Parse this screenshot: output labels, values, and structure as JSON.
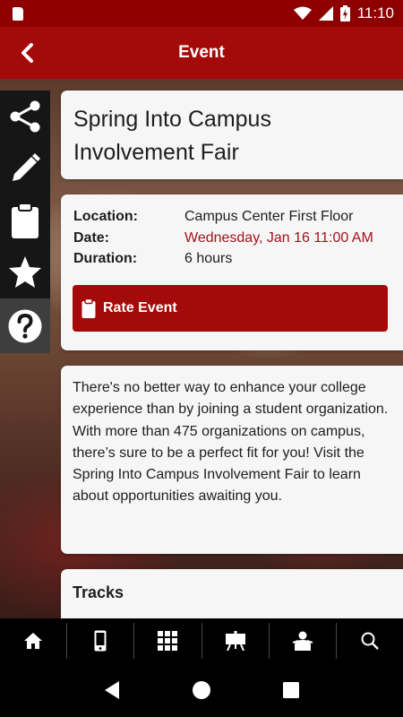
{
  "status_bar": {
    "time": "11:10",
    "icons": [
      "sd-card-icon",
      "wifi-icon",
      "cell-signal-icon",
      "battery-charging-icon"
    ]
  },
  "app_bar": {
    "title": "Event",
    "back_icon": "chevron-left-icon"
  },
  "side_toolbar": {
    "items": [
      {
        "icon": "share-icon"
      },
      {
        "icon": "pencil-icon"
      },
      {
        "icon": "clipboard-icon"
      },
      {
        "icon": "star-icon"
      },
      {
        "icon": "help-icon"
      }
    ]
  },
  "event": {
    "title": "Spring Into Campus Involvement Fair",
    "details": [
      {
        "label": "Location:",
        "value": "Campus Center First Floor"
      },
      {
        "label": "Date:",
        "value": "Wednesday, Jan 16 11:00 AM"
      },
      {
        "label": "Duration:",
        "value": "6 hours"
      }
    ],
    "date_color": "#a0141c",
    "rate_button": {
      "label": "Rate Event",
      "icon": "clipboard-icon"
    },
    "description": "There's no better way to enhance your college experience than by joining a student organization.  With more than 475 organizations on campus, there’s sure to be a perfect fit for you!  Visit the Spring Into Campus Involvement Fair to learn about opportunities awaiting you.",
    "tracks_title": "Tracks"
  },
  "tab_bar": {
    "tabs": [
      {
        "icon": "home-icon"
      },
      {
        "icon": "phone-icon"
      },
      {
        "icon": "qr-grid-icon"
      },
      {
        "icon": "presentation-icon"
      },
      {
        "icon": "person-icon"
      },
      {
        "icon": "search-icon"
      }
    ]
  },
  "nav_bar": {
    "buttons": [
      {
        "icon": "back-triangle-icon"
      },
      {
        "icon": "home-circle-icon"
      },
      {
        "icon": "recents-square-icon"
      }
    ]
  },
  "colors": {
    "brand": "#a50a0a",
    "status_bar": "#8e0000"
  }
}
